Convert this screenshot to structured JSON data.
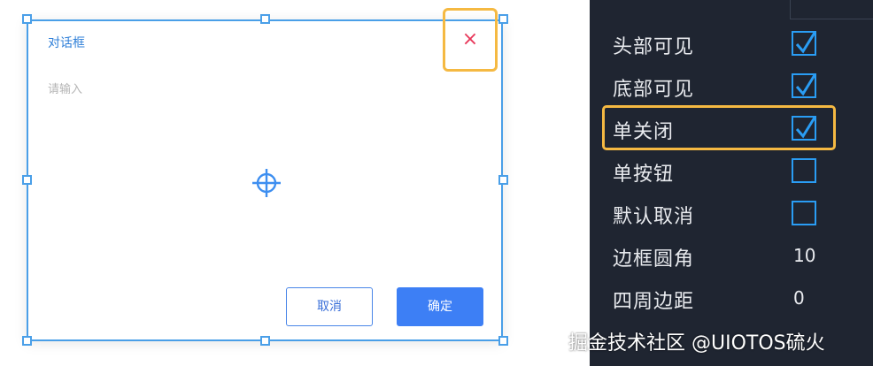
{
  "dialog": {
    "title": "对话框",
    "close_glyph": "×",
    "input_placeholder": "请输入",
    "cancel_label": "取消",
    "ok_label": "确定"
  },
  "panel": {
    "rows": [
      {
        "label": "头部可见",
        "type": "checkbox",
        "checked": true
      },
      {
        "label": "底部可见",
        "type": "checkbox",
        "checked": true
      },
      {
        "label": "单关闭",
        "type": "checkbox",
        "checked": true
      },
      {
        "label": "单按钮",
        "type": "checkbox",
        "checked": false
      },
      {
        "label": "默认取消",
        "type": "checkbox",
        "checked": false
      },
      {
        "label": "边框圆角",
        "type": "value",
        "value": "10"
      },
      {
        "label": "四周边距",
        "type": "value",
        "value": "0"
      }
    ]
  },
  "watermark": "掘金技术社区 @UIOTOS硫火",
  "colors": {
    "accent": "#3d7ff5",
    "selection": "#4a9fe8",
    "highlight": "#f5b942",
    "close": "#e8385a",
    "panel_bg": "#1f2531",
    "checkbox": "#2a9df4"
  },
  "icons": {
    "close": "close-icon",
    "center": "crosshair-icon",
    "check": "checkmark-icon"
  }
}
